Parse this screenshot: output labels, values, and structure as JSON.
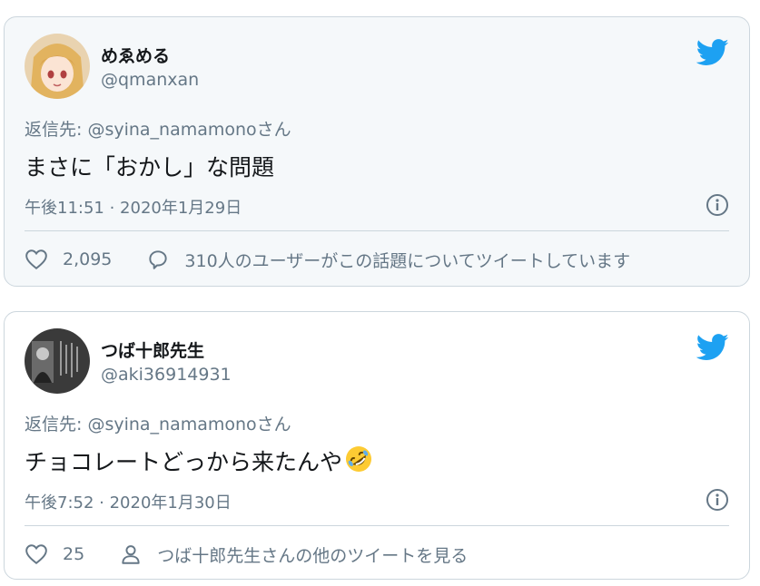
{
  "colors": {
    "accent": "#1da1f2",
    "muted": "#657786",
    "border": "#ccd6dd",
    "highlight_bg": "#f5f8fa"
  },
  "tweets": [
    {
      "name": "めゑめる",
      "handle": "@qmanxan",
      "reply_to": "返信先: @syina_namamonoさん",
      "text": "まさに「おかし」な問題",
      "timestamp": "午後11:51 · 2020年1月29日",
      "likes": "2,095",
      "secondary_action": "310人のユーザーがこの話題についてツイートしています",
      "secondary_icon": "speech-bubble-icon"
    },
    {
      "name": "つば十郎先生",
      "handle": "@aki36914931",
      "reply_to": "返信先: @syina_namamonoさん",
      "text": "チョコレートどっから来たんや",
      "emoji": "rolling-on-floor-laughing-emoji",
      "timestamp": "午後7:52 · 2020年1月30日",
      "likes": "25",
      "secondary_action": "つば十郎先生さんの他のツイートを見る",
      "secondary_icon": "person-icon"
    }
  ]
}
